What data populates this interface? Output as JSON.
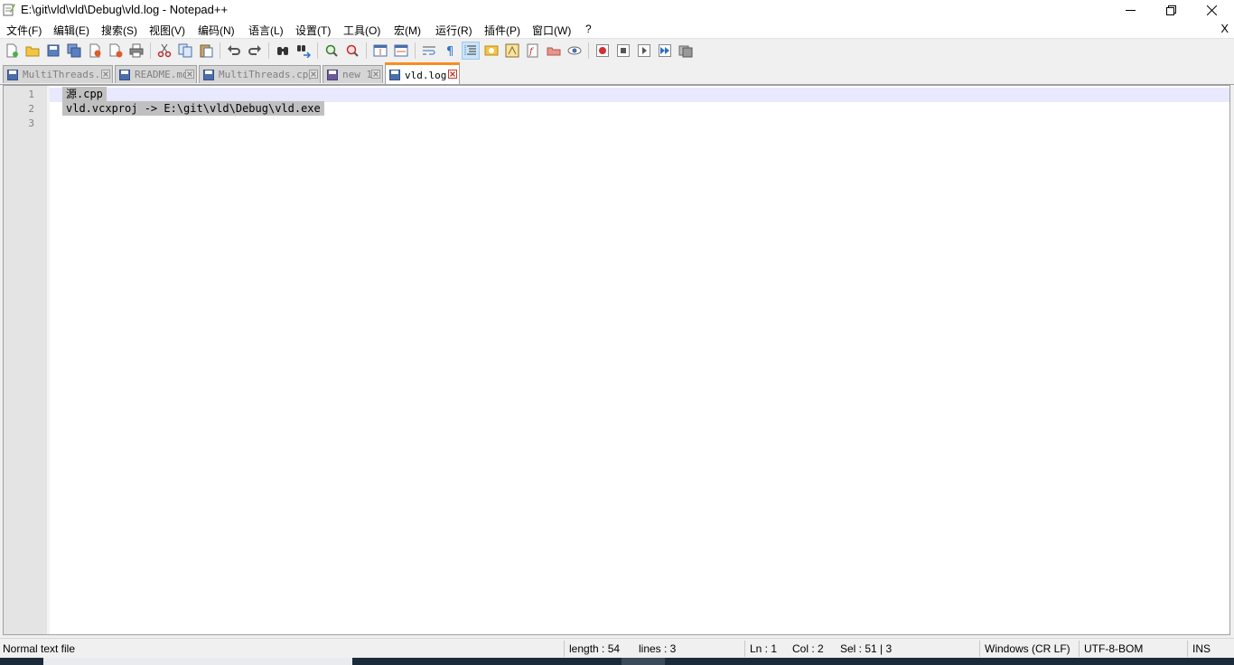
{
  "window": {
    "title": "E:\\git\\vld\\vld\\Debug\\vld.log - Notepad++",
    "minimize_symbol": "—",
    "close_symbol": "✕"
  },
  "menu": {
    "items": [
      "文件(F)",
      "编辑(E)",
      "搜索(S)",
      "视图(V)",
      "编码(N)",
      "语言(L)",
      "设置(T)",
      "工具(O)",
      "宏(M)",
      "运行(R)",
      "插件(P)",
      "窗口(W)",
      "?"
    ],
    "close_doc": "X"
  },
  "toolbar": {
    "icons": [
      "new-file-icon",
      "open-file-icon",
      "save-icon",
      "save-all-icon",
      "close-icon",
      "close-all-icon",
      "print-icon",
      "cut-icon",
      "copy-icon",
      "paste-icon",
      "undo-icon",
      "redo-icon",
      "find-icon",
      "replace-icon",
      "zoom-in-icon",
      "zoom-out-icon",
      "sync-vertical-icon",
      "sync-horizontal-icon",
      "word-wrap-icon",
      "show-all-chars-icon",
      "indent-guide-icon",
      "user-language-icon",
      "doc-map-icon",
      "function-list-icon",
      "folder-workspace-icon",
      "monitoring-icon",
      "record-macro-icon",
      "stop-record-icon",
      "play-macro-icon",
      "run-macro-multiple-icon",
      "save-macro-icon"
    ],
    "active_icon": "indent-guide-icon"
  },
  "tabs": [
    {
      "label": "MultiThreads.h",
      "active": false
    },
    {
      "label": "README.md",
      "active": false
    },
    {
      "label": "MultiThreads.cpp",
      "active": false
    },
    {
      "label": "new 1",
      "active": false
    },
    {
      "label": "vld.log",
      "active": true
    }
  ],
  "editor": {
    "line_numbers": [
      "1",
      "2",
      "3"
    ],
    "lines": [
      "源.cpp",
      "vld.vcxproj -> E:\\git\\vld\\Debug\\vld.exe",
      ""
    ]
  },
  "status": {
    "file_type": "Normal text file",
    "length": "length : 54",
    "lines": "lines : 3",
    "ln": "Ln : 1",
    "col": "Col : 2",
    "sel": "Sel : 51 | 3",
    "eol": "Windows (CR LF)",
    "encoding": "UTF-8-BOM",
    "mode": "INS"
  },
  "colors": {
    "active_tab_accent": "#fa8c1e",
    "selection": "#c0c0c0",
    "current_line": "#e8e8ff"
  }
}
